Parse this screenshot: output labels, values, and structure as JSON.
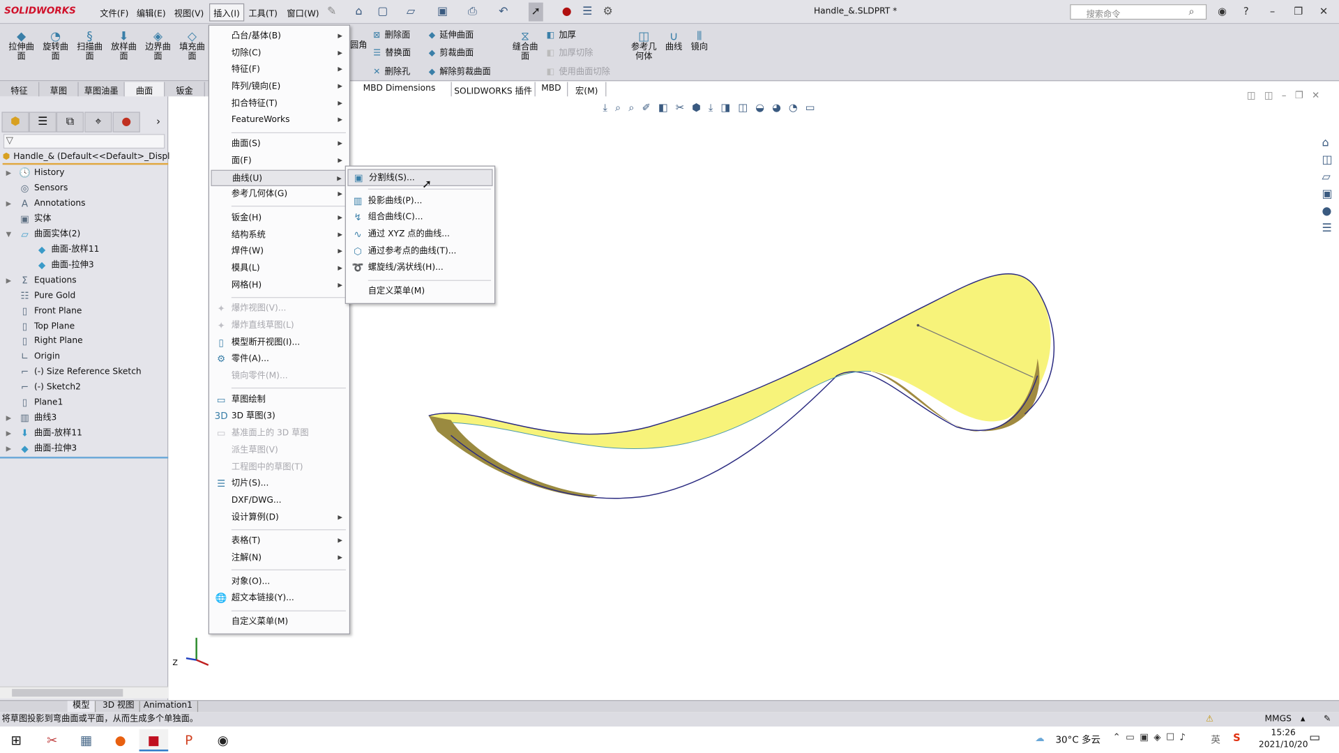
{
  "app": {
    "logo": "SOLIDWORKS",
    "document_title": "Handle_&.SLDPRT *",
    "search_placeholder": "搜索命令"
  },
  "menubar": [
    "文件(F)",
    "编辑(E)",
    "视图(V)",
    "插入(I)",
    "工具(T)",
    "窗口(W)"
  ],
  "ribbon": {
    "large": [
      "拉伸曲面",
      "旋转曲面",
      "扫描曲面",
      "放样曲面",
      "边界曲面",
      "填充曲面"
    ],
    "small": [
      {
        "label": "删除面",
        "enabled": true
      },
      {
        "label": "替换面",
        "enabled": true
      },
      {
        "label": "删除孔",
        "enabled": true
      },
      {
        "label": "延伸曲面",
        "enabled": true
      },
      {
        "label": "剪裁曲面",
        "enabled": true
      },
      {
        "label": "解除剪裁曲面",
        "enabled": true
      },
      {
        "label": "加厚",
        "enabled": true
      },
      {
        "label": "加厚切除",
        "enabled": false
      },
      {
        "label": "使用曲面切除",
        "enabled": false
      }
    ],
    "partial_label": "圆角",
    "knit": "缝合曲面",
    "ref_geometry": "参考几何体",
    "curves": "曲线",
    "mirror": "镜向"
  },
  "tabs": [
    "特征",
    "草图",
    "草图油墨",
    "曲面",
    "钣金",
    "评估",
    "MBD Dimensions",
    "SOLIDWORKS 插件",
    "MBD",
    "宏(M)"
  ],
  "active_tab": "曲面",
  "tree": {
    "root": "Handle_&  (Default<<Default>_Displ",
    "items": [
      {
        "label": "History",
        "icon": "history-folder-icon",
        "expandable": true,
        "indent": 0
      },
      {
        "label": "Sensors",
        "icon": "sensors-folder-icon",
        "expandable": false,
        "indent": 0
      },
      {
        "label": "Annotations",
        "icon": "annotations-folder-icon",
        "expandable": true,
        "indent": 0
      },
      {
        "label": "实体",
        "icon": "solid-bodies-folder-icon",
        "expandable": false,
        "indent": 0
      },
      {
        "label": "曲面实体(2)",
        "icon": "surface-bodies-folder-icon",
        "expandable": true,
        "expanded": true,
        "indent": 0
      },
      {
        "label": "曲面-放样11",
        "icon": "surface-body-icon",
        "expandable": false,
        "indent": 1
      },
      {
        "label": "曲面-拉伸3",
        "icon": "surface-body-icon",
        "expandable": false,
        "indent": 1
      },
      {
        "label": "Equations",
        "icon": "equations-folder-icon",
        "expandable": true,
        "indent": 0
      },
      {
        "label": "Pure Gold",
        "icon": "material-icon",
        "expandable": false,
        "indent": 0
      },
      {
        "label": "Front Plane",
        "icon": "plane-icon",
        "expandable": false,
        "indent": 0
      },
      {
        "label": "Top Plane",
        "icon": "plane-icon",
        "expandable": false,
        "indent": 0
      },
      {
        "label": "Right Plane",
        "icon": "plane-icon",
        "expandable": false,
        "indent": 0
      },
      {
        "label": "Origin",
        "icon": "origin-icon",
        "expandable": false,
        "indent": 0
      },
      {
        "label": "(-) Size Reference Sketch",
        "icon": "sketch-icon",
        "expandable": false,
        "indent": 0
      },
      {
        "label": "(-) Sketch2",
        "icon": "sketch-icon",
        "expandable": false,
        "indent": 0
      },
      {
        "label": "Plane1",
        "icon": "plane-icon",
        "expandable": false,
        "indent": 0
      },
      {
        "label": "曲线3",
        "icon": "projected-curve-icon",
        "expandable": true,
        "indent": 0
      },
      {
        "label": "曲面-放样11",
        "icon": "surface-loft-icon",
        "expandable": true,
        "indent": 0
      },
      {
        "label": "曲面-拉伸3",
        "icon": "surface-extrude-icon",
        "expandable": true,
        "indent": 0
      }
    ]
  },
  "insert_menu": [
    {
      "label": "凸台/基体(B)",
      "sub": true
    },
    {
      "label": "切除(C)",
      "sub": true
    },
    {
      "label": "特征(F)",
      "sub": true
    },
    {
      "label": "阵列/镜向(E)",
      "sub": true
    },
    {
      "label": "扣合特征(T)",
      "sub": true
    },
    {
      "label": "FeatureWorks",
      "sub": true
    },
    {
      "sep": true
    },
    {
      "label": "曲面(S)",
      "sub": true
    },
    {
      "label": "面(F)",
      "sub": true
    },
    {
      "label": "曲线(U)",
      "sub": true,
      "highlight": true
    },
    {
      "label": "参考几何体(G)",
      "sub": true
    },
    {
      "sep": true
    },
    {
      "label": "钣金(H)",
      "sub": true
    },
    {
      "label": "结构系统",
      "sub": true
    },
    {
      "label": "焊件(W)",
      "sub": true
    },
    {
      "label": "模具(L)",
      "sub": true
    },
    {
      "label": "网格(H)",
      "sub": true
    },
    {
      "sep": true
    },
    {
      "label": "爆炸视图(V)...",
      "disabled": true,
      "icon": "✦"
    },
    {
      "label": "爆炸直线草图(L)",
      "disabled": true,
      "icon": "✦"
    },
    {
      "label": "模型断开视图(I)...",
      "icon": "▯"
    },
    {
      "label": "零件(A)...",
      "icon": "⚙"
    },
    {
      "label": "镜向零件(M)...",
      "disabled": true
    },
    {
      "sep": true
    },
    {
      "label": "草图绘制",
      "icon": "▭"
    },
    {
      "label": "3D 草图(3)",
      "icon": "3D"
    },
    {
      "label": "基准面上的 3D 草图",
      "disabled": true,
      "icon": "▭"
    },
    {
      "label": "派生草图(V)",
      "disabled": true
    },
    {
      "label": "工程图中的草图(T)",
      "disabled": true
    },
    {
      "label": "切片(S)...",
      "icon": "☰"
    },
    {
      "label": "DXF/DWG..."
    },
    {
      "label": "设计算例(D)",
      "sub": true
    },
    {
      "sep": true
    },
    {
      "label": "表格(T)",
      "sub": true
    },
    {
      "label": "注解(N)",
      "sub": true
    },
    {
      "sep": true
    },
    {
      "label": "对象(O)..."
    },
    {
      "label": "超文本链接(Y)...",
      "icon": "🌐"
    },
    {
      "sep": true
    },
    {
      "label": "自定义菜单(M)"
    }
  ],
  "curve_submenu": [
    {
      "label": "分割线(S)...",
      "icon": "▣",
      "highlight": true
    },
    {
      "sep": true
    },
    {
      "label": "投影曲线(P)...",
      "icon": "▥"
    },
    {
      "label": "组合曲线(C)...",
      "icon": "↯"
    },
    {
      "label": "通过 XYZ 点的曲线...",
      "icon": "∿"
    },
    {
      "label": "通过参考点的曲线(T)...",
      "icon": "⬡"
    },
    {
      "label": "螺旋线/涡状线(H)...",
      "icon": "➰"
    },
    {
      "sep": true
    },
    {
      "label": "自定义菜单(M)"
    }
  ],
  "bottom_tabs": [
    "模型",
    "3D 视图",
    "Animation1"
  ],
  "status": {
    "message": "将草图投影到弯曲面或平面，从而生成多个单独面。",
    "units": "MMGS"
  },
  "taskbar": {
    "weather": "30°C 多云",
    "time": "15:26",
    "date": "2021/10/20",
    "ime": "英"
  },
  "colors": {
    "surface": "#f7f37a",
    "edge": "#2a2a80",
    "accent": "#d0102a"
  }
}
